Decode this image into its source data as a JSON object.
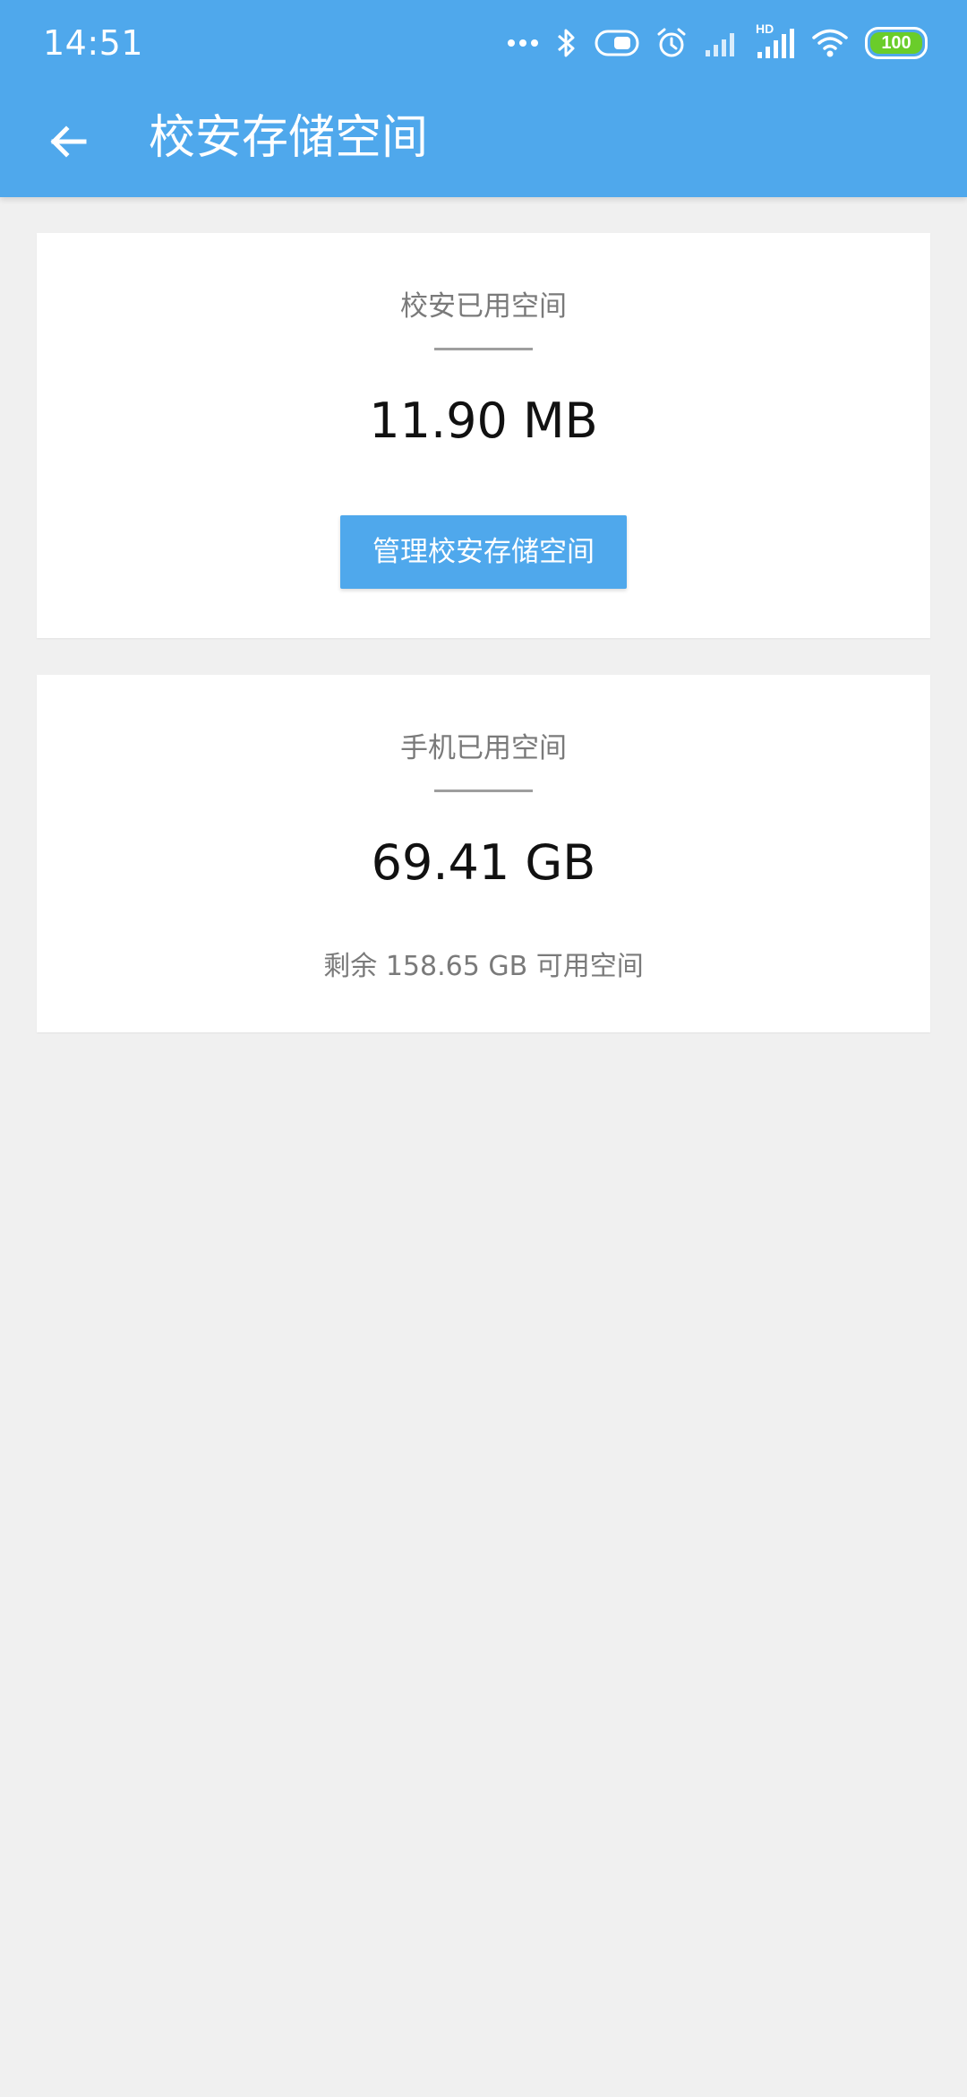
{
  "status_bar": {
    "time": "14:51",
    "battery_level": "100",
    "icons": [
      "more-dots-icon",
      "bluetooth-icon",
      "toggle-icon",
      "alarm-icon",
      "signal-icon",
      "hd-signal-icon",
      "wifi-icon",
      "battery-icon"
    ],
    "hd_label": "HD"
  },
  "toolbar": {
    "back_icon": "arrow-left-icon",
    "title": "校安存储空间"
  },
  "app_card": {
    "label": "校安已用空间",
    "value": "11.90 MB",
    "button_label": "管理校安存储空间"
  },
  "phone_card": {
    "label": "手机已用空间",
    "value": "69.41 GB",
    "remaining": "剩余 158.65 GB 可用空间"
  },
  "colors": {
    "accent": "#4fa8ec",
    "battery_fill": "#6acd2a",
    "background": "#f0f0f0"
  }
}
